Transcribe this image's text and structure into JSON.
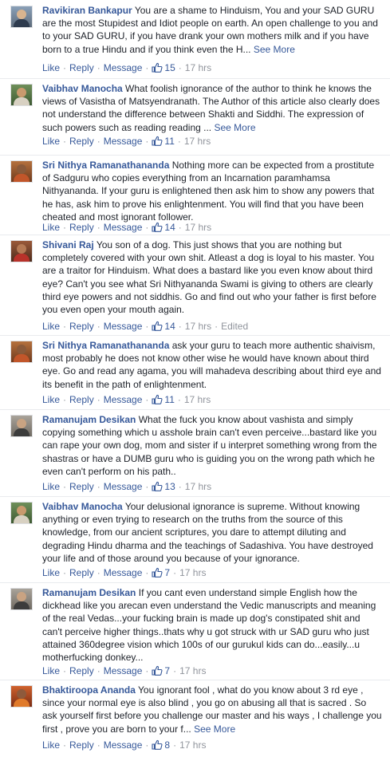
{
  "labels": {
    "like": "Like",
    "reply": "Reply",
    "message": "Message",
    "see_more": "See More",
    "sep": "·"
  },
  "colors": {
    "link": "#365899",
    "meta": "#90949c",
    "text": "#1d2129"
  },
  "comments": [
    {
      "author": "Ravikiran Bankapur",
      "text": "You are a shame to Hinduism, You and your SAD GURU are the most Stupidest and Idiot people on earth. An open challenge to you and to your SAD GURU, if you have drank your own mothers milk and if you have born to a true Hindu and if you think even the H...",
      "see_more": true,
      "likes": "15",
      "time": "17 hrs",
      "edited": ""
    },
    {
      "author": "Vaibhav Manocha",
      "text": "What foolish ignorance of the author to think he knows the views of Vasistha of Matsyendranath. The Author of this article also clearly does not understand the difference between Shakti and Siddhi. The expression of such powers such as reading reading ...",
      "see_more": true,
      "likes": "11",
      "time": "17 hrs",
      "edited": ""
    },
    {
      "author": "Sri Nithya Ramanathananda",
      "text": "Nothing more can be expected from a prostitute of Sadguru who copies everything from an Incarnation paramhamsa Nithyananda. If your guru is enlightened then ask him to show any powers that he has, ask him to prove his enlightenment. You will find that you have been cheated and most ignorant follower.",
      "see_more": false,
      "likes": "14",
      "time": "17 hrs",
      "edited": ""
    },
    {
      "author": "Shivani Raj",
      "text": "You son of a dog. This just shows that you are nothing but completely covered with your own shit. Atleast a dog is loyal to his master. You are a traitor for Hinduism. What does a bastard like you even know about third eye? Can't you see what Sri Nithyananda Swami is giving to others are clearly third eye powers and not siddhis. Go and find out who your father is first before you even open your mouth again.",
      "see_more": false,
      "likes": "14",
      "time": "17 hrs",
      "edited": "Edited"
    },
    {
      "author": "Sri Nithya Ramanathananda",
      "text": "ask your guru to teach more authentic shaivism, most probably he does not know other wise he would have known about third eye. Go and read any agama, you will mahadeva describing about third eye and its benefit in the path of enlightenment.",
      "see_more": false,
      "likes": "11",
      "time": "17 hrs",
      "edited": ""
    },
    {
      "author": "Ramanujam Desikan",
      "text": "What the fuck you know about vashista and simply copying something which u asshole brain can't even perceive...bastard like you can rape your own dog, mom and sister if u interpret something wrong from the shastras or have a DUMB guru who is guiding you on the wrong path which he even can't perform on his path..",
      "see_more": false,
      "likes": "13",
      "time": "17 hrs",
      "edited": ""
    },
    {
      "author": "Vaibhav Manocha",
      "text": "Your delusional ignorance is supreme. Without knowing anything or even trying to research on the truths from the source of this knowledge, from our ancient scriptures, you dare to attempt diluting and degrading Hindu dharma and the teachings of Sadashiva. You have destroyed your life and of those around you because of your ignorance.",
      "see_more": false,
      "likes": "7",
      "time": "17 hrs",
      "edited": ""
    },
    {
      "author": "Ramanujam Desikan",
      "text": "If you cant even understand simple English how the dickhead like you arecan even understand the Vedic manuscripts and meaning of the real Vedas...your fucking brain is made up dog's constipated shit and can't perceive higher things..thats why u got struck with ur SAD guru who just attained 360degree vision which 100s of our gurukul kids can do...easily...u motherfucking donkey...",
      "see_more": false,
      "likes": "7",
      "time": "17 hrs",
      "edited": ""
    },
    {
      "author": "Bhaktiroopa Ananda",
      "text": "You ignorant fool , what do you know about 3 rd eye , since your normal eye is also blind , you go on abusing all that is sacred . So ask yourself first before you challenge our master and his ways , I challenge you first , prove you are born to your f...",
      "see_more": true,
      "likes": "8",
      "time": "17 hrs",
      "edited": ""
    }
  ]
}
